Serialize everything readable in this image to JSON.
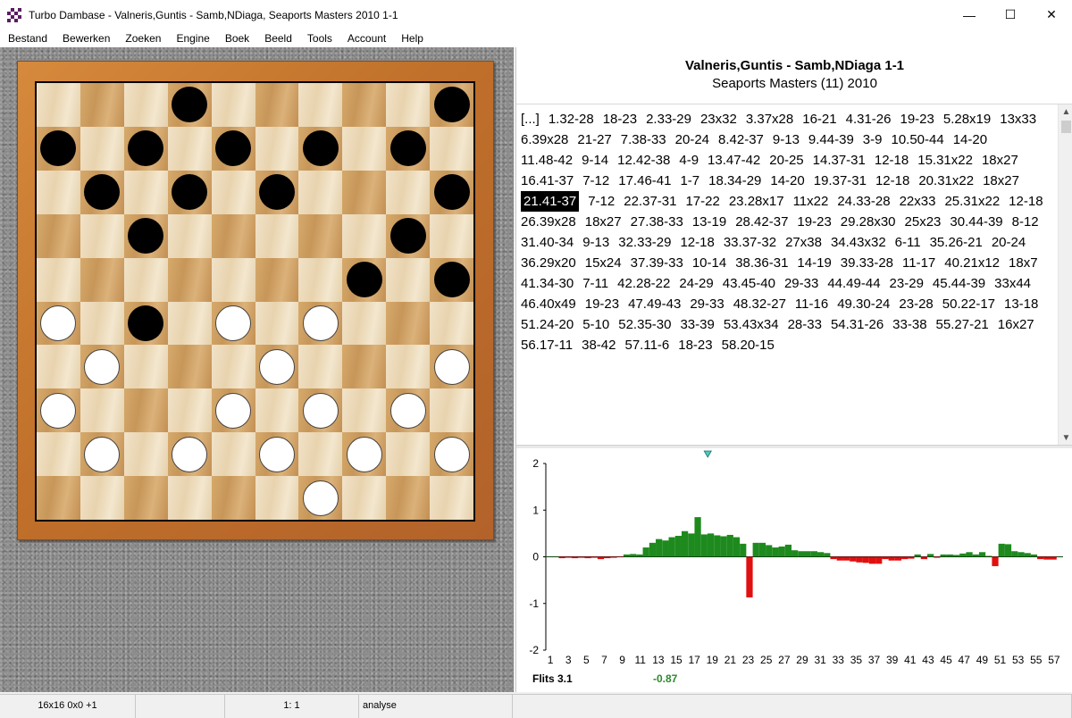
{
  "window": {
    "title": "Turbo Dambase - Valneris,Guntis - Samb,NDiaga, Seaports Masters 2010 1-1",
    "minimize_glyph": "—",
    "maximize_glyph": "☐",
    "close_glyph": "✕"
  },
  "menu": [
    "Bestand",
    "Bewerken",
    "Zoeken",
    "Engine",
    "Boek",
    "Beeld",
    "Tools",
    "Account",
    "Help"
  ],
  "board": {
    "light_square_color": "#f1e2c8",
    "dark_square_color": "#c79659",
    "frame_color": "#c0702a",
    "pieces": [
      {
        "row": 0,
        "col": 3,
        "color": "black"
      },
      {
        "row": 0,
        "col": 9,
        "color": "black"
      },
      {
        "row": 1,
        "col": 0,
        "color": "black"
      },
      {
        "row": 1,
        "col": 2,
        "color": "black"
      },
      {
        "row": 1,
        "col": 4,
        "color": "black"
      },
      {
        "row": 1,
        "col": 6,
        "color": "black"
      },
      {
        "row": 1,
        "col": 8,
        "color": "black"
      },
      {
        "row": 2,
        "col": 1,
        "color": "black"
      },
      {
        "row": 2,
        "col": 3,
        "color": "black"
      },
      {
        "row": 2,
        "col": 5,
        "color": "black"
      },
      {
        "row": 2,
        "col": 9,
        "color": "black"
      },
      {
        "row": 3,
        "col": 2,
        "color": "black"
      },
      {
        "row": 3,
        "col": 8,
        "color": "black"
      },
      {
        "row": 4,
        "col": 7,
        "color": "black"
      },
      {
        "row": 4,
        "col": 9,
        "color": "black"
      },
      {
        "row": 5,
        "col": 0,
        "color": "white"
      },
      {
        "row": 5,
        "col": 2,
        "color": "black"
      },
      {
        "row": 5,
        "col": 4,
        "color": "white"
      },
      {
        "row": 5,
        "col": 6,
        "color": "white"
      },
      {
        "row": 6,
        "col": 1,
        "color": "white"
      },
      {
        "row": 6,
        "col": 5,
        "color": "white"
      },
      {
        "row": 6,
        "col": 9,
        "color": "white"
      },
      {
        "row": 7,
        "col": 0,
        "color": "white"
      },
      {
        "row": 7,
        "col": 4,
        "color": "white"
      },
      {
        "row": 7,
        "col": 6,
        "color": "white"
      },
      {
        "row": 7,
        "col": 8,
        "color": "white"
      },
      {
        "row": 8,
        "col": 1,
        "color": "white"
      },
      {
        "row": 8,
        "col": 3,
        "color": "white"
      },
      {
        "row": 8,
        "col": 5,
        "color": "white"
      },
      {
        "row": 8,
        "col": 7,
        "color": "white"
      },
      {
        "row": 8,
        "col": 9,
        "color": "white"
      },
      {
        "row": 9,
        "col": 6,
        "color": "white"
      }
    ]
  },
  "game": {
    "players": "Valneris,Guntis - Samb,NDiaga 1-1",
    "event": "Seaports Masters (11) 2010"
  },
  "moves": {
    "selected_index": 41,
    "items": [
      "[...]",
      "1.32-28",
      "18-23",
      "2.33-29",
      "23x32",
      "3.37x28",
      "16-21",
      "4.31-26",
      "19-23",
      "5.28x19",
      "13x33",
      "6.39x28",
      "21-27",
      "7.38-33",
      "20-24",
      "8.42-37",
      "9-13",
      "9.44-39",
      "3-9",
      "10.50-44",
      "14-20",
      "11.48-42",
      "9-14",
      "12.42-38",
      "4-9",
      "13.47-42",
      "20-25",
      "14.37-31",
      "12-18",
      "15.31x22",
      "18x27",
      "16.41-37",
      "7-12",
      "17.46-41",
      "1-7",
      "18.34-29",
      "14-20",
      "19.37-31",
      "12-18",
      "20.31x22",
      "18x27",
      "21.41-37",
      "7-12",
      "22.37-31",
      "17-22",
      "23.28x17",
      "11x22",
      "24.33-28",
      "22x33",
      "25.31x22",
      "12-18",
      "26.39x28",
      "18x27",
      "27.38-33",
      "13-19",
      "28.42-37",
      "19-23",
      "29.28x30",
      "25x23",
      "30.44-39",
      "8-12",
      "31.40-34",
      "9-13",
      "32.33-29",
      "12-18",
      "33.37-32",
      "27x38",
      "34.43x32",
      "6-11",
      "35.26-21",
      "20-24",
      "36.29x20",
      "15x24",
      "37.39-33",
      "10-14",
      "38.36-31",
      "14-19",
      "39.33-28",
      "11-17",
      "40.21x12",
      "18x7",
      "41.34-30",
      "7-11",
      "42.28-22",
      "24-29",
      "43.45-40",
      "29-33",
      "44.49-44",
      "23-29",
      "45.44-39",
      "33x44",
      "46.40x49",
      "19-23",
      "47.49-43",
      "29-33",
      "48.32-27",
      "11-16",
      "49.30-24",
      "23-28",
      "50.22-17",
      "13-18",
      "51.24-20",
      "5-10",
      "52.35-30",
      "33-39",
      "53.43x34",
      "28-33",
      "54.31-26",
      "33-38",
      "55.27-21",
      "16x27",
      "56.17-11",
      "38-42",
      "57.11-6",
      "18-23",
      "58.20-15"
    ]
  },
  "scroll": {
    "up_glyph": "▲",
    "down_glyph": "▼"
  },
  "chart_data": {
    "type": "bar",
    "title": "",
    "xlabel": "",
    "ylabel": "",
    "ylim": [
      -2,
      2
    ],
    "yticks": [
      "2",
      "1",
      "0",
      "-1",
      "-2"
    ],
    "xticks": [
      "1",
      "3",
      "5",
      "7",
      "9",
      "11",
      "13",
      "15",
      "17",
      "19",
      "21",
      "23",
      "25",
      "27",
      "29",
      "31",
      "33",
      "35",
      "37",
      "39",
      "41",
      "43",
      "45",
      "47",
      "49",
      "51",
      "53",
      "55",
      "57"
    ],
    "x_range": [
      0.5,
      58.0
    ],
    "marker_move": 18.5,
    "positive_color": "#1e8a1e",
    "negative_color": "#e01010",
    "values": [
      0,
      0,
      -0.03,
      -0.02,
      -0.03,
      -0.02,
      -0.03,
      -0.02,
      -0.05,
      -0.03,
      -0.02,
      -0.01,
      0.05,
      0.06,
      0.05,
      0.2,
      0.3,
      0.38,
      0.35,
      0.42,
      0.45,
      0.55,
      0.5,
      0.85,
      0.48,
      0.5,
      0.46,
      0.44,
      0.47,
      0.42,
      0.28,
      -0.87,
      0.3,
      0.3,
      0.25,
      0.2,
      0.22,
      0.26,
      0.14,
      0.12,
      0.12,
      0.12,
      0.1,
      0.08,
      -0.05,
      -0.08,
      -0.08,
      -0.1,
      -0.12,
      -0.13,
      -0.15,
      -0.15,
      -0.05,
      -0.08,
      -0.08,
      -0.05,
      -0.04,
      0.05,
      -0.05,
      0.06,
      -0.02,
      0.05,
      0.05,
      0.04,
      0.07,
      0.1,
      0.05,
      0.1,
      0.02,
      -0.2,
      0.28,
      0.27,
      0.12,
      0.1,
      0.08,
      0.05,
      -0.05,
      -0.06,
      -0.06,
      0.0
    ]
  },
  "eval": {
    "engine": "Flits 3.1",
    "value": "-0.87"
  },
  "statusbar": [
    {
      "text": "16x16 0x0 +1",
      "align": "center"
    },
    {
      "text": "",
      "align": "center"
    },
    {
      "text": "1: 1",
      "align": "center"
    },
    {
      "text": "analyse",
      "align": "left"
    },
    {
      "text": "",
      "align": "left"
    }
  ]
}
